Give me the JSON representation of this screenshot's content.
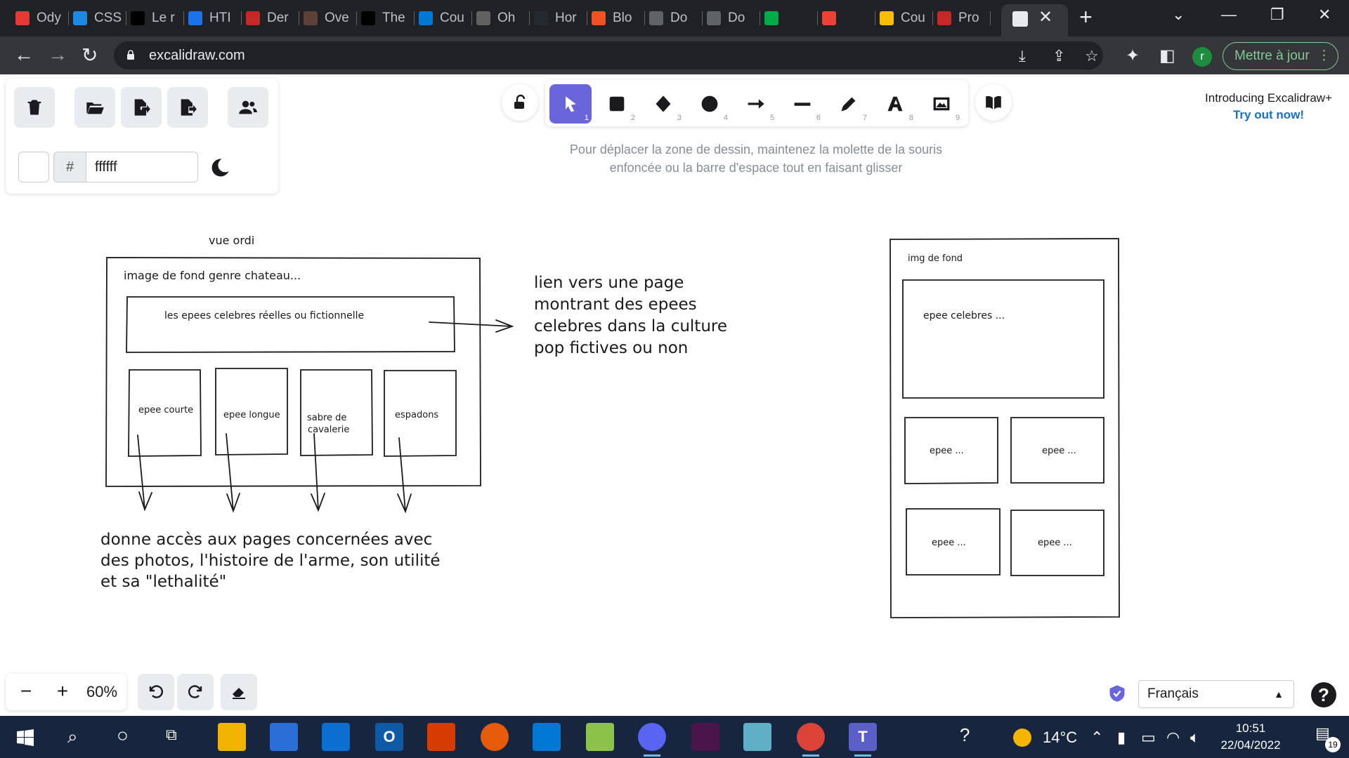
{
  "browser": {
    "tabs": [
      {
        "title": "Ody",
        "color": "#e53935"
      },
      {
        "title": "CSS",
        "color": "#1e88e5"
      },
      {
        "title": "Le r",
        "color": "#000000"
      },
      {
        "title": "HTI",
        "color": "#1a73e8"
      },
      {
        "title": "Der",
        "color": "#c62828"
      },
      {
        "title": "Ove",
        "color": "#5d4037"
      },
      {
        "title": "The",
        "color": "#000000"
      },
      {
        "title": "Cou",
        "color": "#0078d4"
      },
      {
        "title": "Oh",
        "color": "#616161"
      },
      {
        "title": "Hor",
        "color": "#24292f"
      },
      {
        "title": "Blo",
        "color": "#f25022"
      },
      {
        "title": "Do",
        "color": "#5f6368"
      },
      {
        "title": "Do",
        "color": "#5f6368"
      },
      {
        "title": "",
        "color": "#00ac47"
      },
      {
        "title": "",
        "color": "#ea4335"
      },
      {
        "title": "Cou",
        "color": "#fbbc04"
      },
      {
        "title": "Pro",
        "color": "#c62828"
      }
    ],
    "new_tab": "+",
    "url": "excalidraw.com",
    "update_label": "Mettre à jour",
    "profile_initial": "r"
  },
  "excalidraw": {
    "color_hash": "#",
    "background_hex": "ffffff",
    "tools": [
      {
        "name": "selection",
        "key": "1"
      },
      {
        "name": "rectangle",
        "key": "2"
      },
      {
        "name": "diamond",
        "key": "3"
      },
      {
        "name": "ellipse",
        "key": "4"
      },
      {
        "name": "arrow",
        "key": "5"
      },
      {
        "name": "line",
        "key": "6"
      },
      {
        "name": "draw",
        "key": "7"
      },
      {
        "name": "text",
        "key": "8"
      },
      {
        "name": "image",
        "key": "9"
      }
    ],
    "hint_line1": "Pour déplacer la zone de dessin, maintenez la molette de la souris",
    "hint_line2": "enfoncée ou la barre d'espace tout en faisant glisser",
    "promo_title": "Introducing Excalidraw+",
    "promo_link": "Try out now!",
    "zoom": "60%",
    "language": "Français",
    "accent_color": "#6965db"
  },
  "sketch": {
    "desktop_label": "vue ordi",
    "desktop_bg_note": "image de fond genre chateau...",
    "desktop_banner": "les epees celebres réelles ou fictionnelle",
    "cards": [
      "epee courte",
      "epee longue",
      "sabre de",
      "cavalerie",
      "espadons"
    ],
    "link_note": [
      "lien vers une page",
      "montrant des epees",
      "celebres dans la culture",
      "pop fictives ou non"
    ],
    "bottom_note": [
      "donne accès aux pages concernées avec",
      "des photos, l'histoire de l'arme, son utilité",
      "et sa \"lethalité\""
    ],
    "mobile_bg": "img de fond",
    "mobile_banner": "epee celebres ...",
    "mobile_cards": [
      "epee ...",
      "epee ...",
      "epee ...",
      "epee ..."
    ]
  },
  "taskbar": {
    "weather": "14°C",
    "time": "10:51",
    "date": "22/04/2022",
    "notifications": "19"
  }
}
